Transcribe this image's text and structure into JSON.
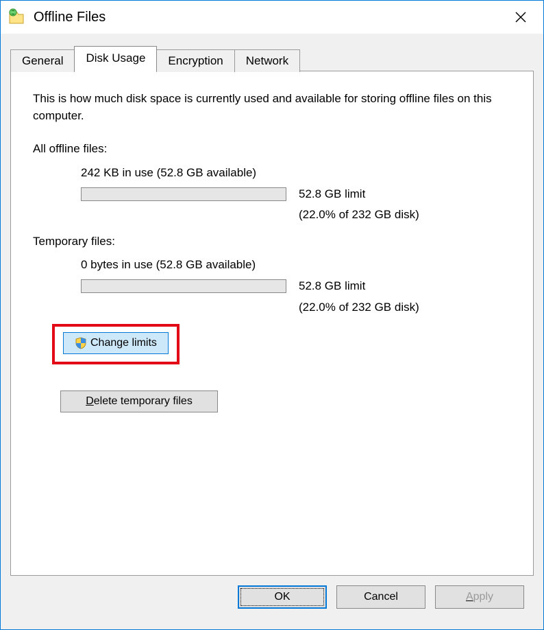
{
  "titlebar": {
    "title": "Offline Files"
  },
  "tabs": {
    "general": "General",
    "disk_usage": "Disk Usage",
    "encryption": "Encryption",
    "network": "Network"
  },
  "disk_usage": {
    "description": "This is how much disk space is currently used and available for storing offline files on this computer.",
    "all_offline": {
      "label": "All offline files:",
      "usage": "242 KB in use (52.8 GB available)",
      "limit": "52.8 GB limit",
      "percent": "(22.0% of 232 GB disk)"
    },
    "temp": {
      "label": "Temporary files:",
      "usage": "0 bytes in use (52.8 GB available)",
      "limit": "52.8 GB limit",
      "percent": "(22.0% of 232 GB disk)"
    },
    "change_limits_label": "Change limits",
    "delete_temp_prefix": "D",
    "delete_temp_rest": "elete temporary files"
  },
  "footer": {
    "ok": "OK",
    "cancel": "Cancel",
    "apply_prefix": "A",
    "apply_rest": "pply"
  }
}
